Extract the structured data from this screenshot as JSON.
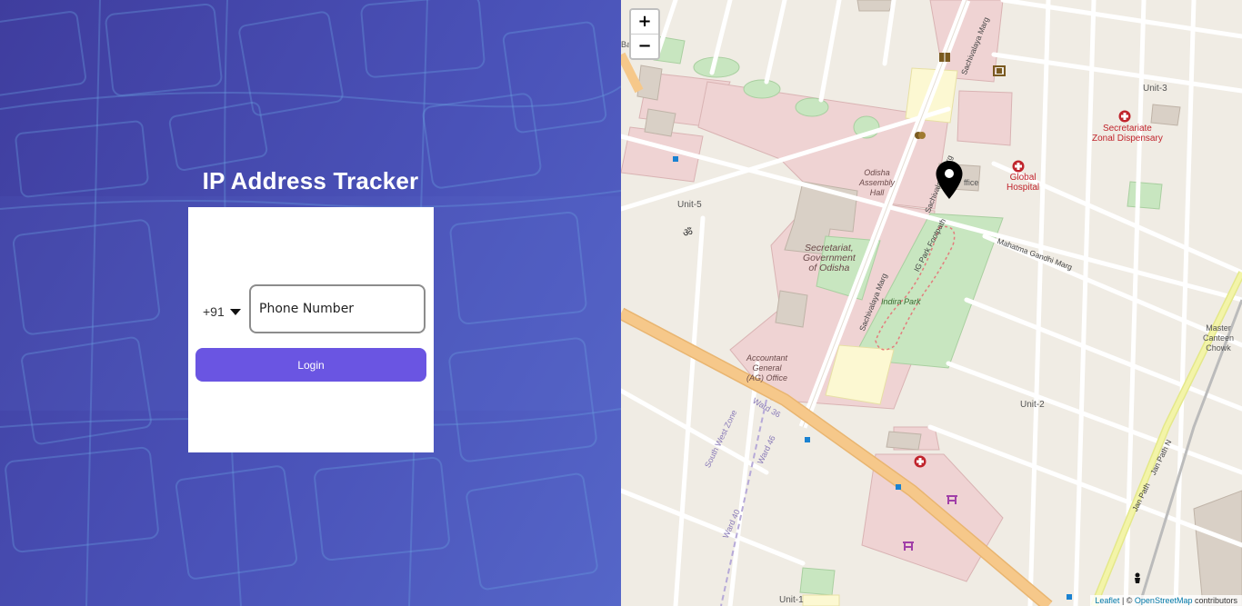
{
  "app": {
    "title": "IP Address Tracker"
  },
  "login": {
    "country_code": "+91",
    "phone_placeholder": "Phone Number",
    "login_button": "Login"
  },
  "map": {
    "zoom_in": "+",
    "zoom_out": "−",
    "labels": {
      "unit3": "Unit-3",
      "unit5": "Unit-5",
      "unit2": "Unit-2",
      "unit1": "Unit-1",
      "secretariate_dispensary_1": "Secretariate",
      "secretariate_dispensary_2": "Zonal Dispensary",
      "global_hospital_1": "Global",
      "global_hospital_2": "Hospital",
      "assembly_1": "Odisha",
      "assembly_2": "Assembly",
      "assembly_3": "Hall",
      "secretariat_1": "Secretariat,",
      "secretariat_2": "Government",
      "secretariat_3": "of Odisha",
      "indira_park": "Indira Park",
      "ag_office_1": "Accountant",
      "ag_office_2": "General",
      "ag_office_3": "(AG) Office",
      "master_canteen_1": "Master",
      "master_canteen_2": "Canteen",
      "master_canteen_3": "Chowk",
      "office_partial": "ffice",
      "sachivalaya_marg_top": "Sachivalaya Marg",
      "sachivalaya_marg_mid": "Sachivalaya Marg",
      "sachivalaya_marg_low": "Sachivalaya Marg",
      "ig_park_footpath": "IG Park Footpath",
      "mahatma_gandhi_marg": "Mahatma Gandhi Marg",
      "jan_path": "Jan Path",
      "jan_path_n": "Jan Path N",
      "ward36": "Ward 36",
      "ward46": "Ward 46",
      "ward40": "Ward 40",
      "south_west_zone": "South West Zone",
      "left_edge_partial": "Ba"
    },
    "attribution": {
      "leaflet": "Leaflet",
      "separator": " | © ",
      "osm": "OpenStreetMap",
      "contributors": " contributors"
    }
  },
  "colors": {
    "button": "#6a55e2",
    "panel_start": "#3f3d9e",
    "panel_end": "#5566c8",
    "hospital_red": "#c0242c",
    "park_green": "#c8e6c0",
    "gov_pink": "#efd3d3",
    "highway_orange": "#f6c88a"
  },
  "icons": {
    "marker": "map-pin-icon",
    "country_dropdown": "caret-down-icon",
    "hospital": "hospital-cross-icon"
  }
}
